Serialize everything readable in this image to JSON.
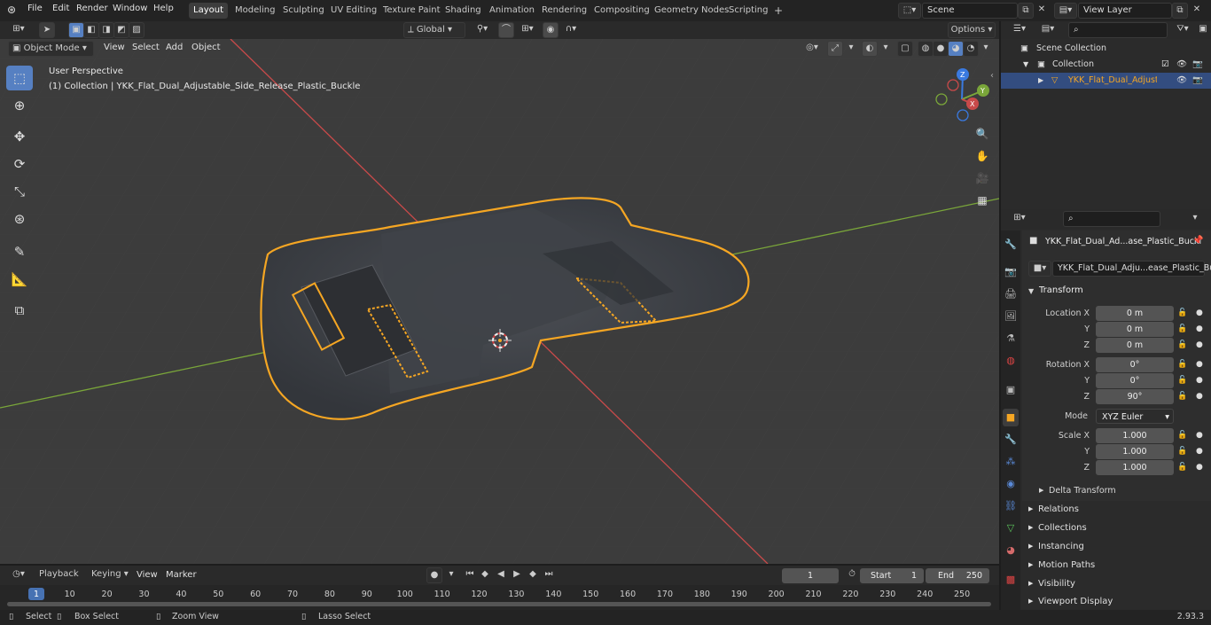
{
  "menu": {
    "file": "File",
    "edit": "Edit",
    "render": "Render",
    "window": "Window",
    "help": "Help"
  },
  "workspaces": [
    "Layout",
    "Modeling",
    "Sculpting",
    "UV Editing",
    "Texture Paint",
    "Shading",
    "Animation",
    "Rendering",
    "Compositing",
    "Geometry Nodes",
    "Scripting"
  ],
  "scene": {
    "name": "Scene"
  },
  "view_layer": {
    "name": "View Layer"
  },
  "header": {
    "transform_orientation": "Global",
    "options": "Options"
  },
  "viewport_header": {
    "mode": "Object Mode",
    "view": "View",
    "select": "Select",
    "add": "Add",
    "object": "Object"
  },
  "viewport": {
    "perspective": "User Perspective",
    "collection_info": "(1) Collection | YKK_Flat_Dual_Adjustable_Side_Release_Plastic_Buckle"
  },
  "gizmo": {
    "x": "X",
    "y": "Y",
    "z": "Z"
  },
  "outliner": {
    "scene_collection": "Scene Collection",
    "collection": "Collection",
    "object": "YKK_Flat_Dual_Adjustable"
  },
  "properties": {
    "object_name": "YKK_Flat_Dual_Ad...ase_Plastic_Buckl",
    "data_name": "YKK_Flat_Dual_Adju...ease_Plastic_Buckle",
    "transform_title": "Transform",
    "location_label": "Location X",
    "y_label": "Y",
    "z_label": "Z",
    "location": [
      "0 m",
      "0 m",
      "0 m"
    ],
    "rotation_label": "Rotation X",
    "rotation": [
      "0°",
      "0°",
      "90°"
    ],
    "mode_label": "Mode",
    "mode": "XYZ Euler",
    "scale_label": "Scale X",
    "scale": [
      "1.000",
      "1.000",
      "1.000"
    ],
    "delta_transform": "Delta Transform",
    "sections": [
      "Relations",
      "Collections",
      "Instancing",
      "Motion Paths",
      "Visibility",
      "Viewport Display"
    ]
  },
  "timeline": {
    "playback": "Playback",
    "keying": "Keying",
    "view": "View",
    "marker": "Marker",
    "current_frame": "1",
    "start_label": "Start",
    "start": "1",
    "end_label": "End",
    "end": "250",
    "ticks": [
      "1",
      "10",
      "20",
      "30",
      "40",
      "50",
      "60",
      "70",
      "80",
      "90",
      "100",
      "110",
      "120",
      "130",
      "140",
      "150",
      "160",
      "170",
      "180",
      "190",
      "200",
      "210",
      "220",
      "230",
      "240",
      "250"
    ]
  },
  "status": {
    "select": "Select",
    "box_select": "Box Select",
    "zoom_view": "Zoom View",
    "lasso_select": "Lasso Select",
    "version": "2.93.3"
  },
  "colors": {
    "accent": "#5680c2",
    "selection": "#f5a623",
    "x_axis": "#c84a4a",
    "y_axis": "#7aa63a",
    "z_axis": "#3a7ae0"
  }
}
